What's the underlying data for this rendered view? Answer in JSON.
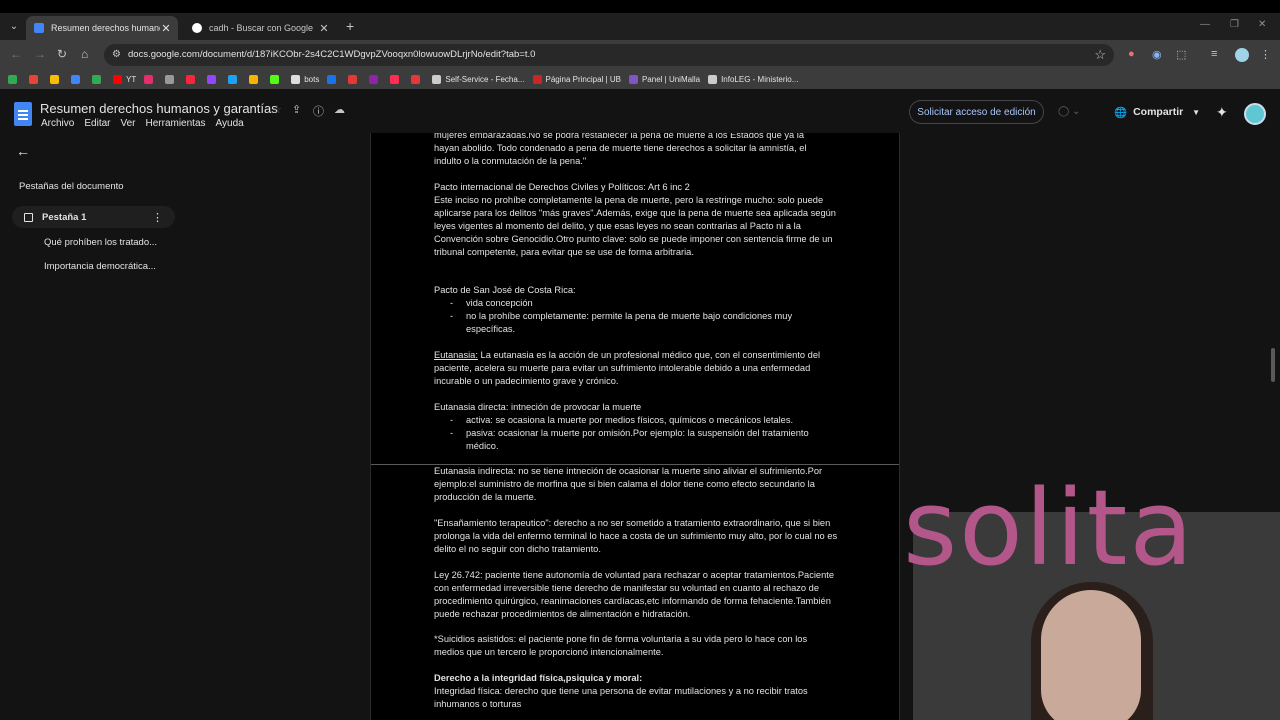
{
  "browser": {
    "tabs": [
      {
        "title": "Resumen derechos humanos y",
        "active": true,
        "favicon": "docs-icon"
      },
      {
        "title": "cadh - Buscar con Google",
        "active": false,
        "favicon": "google-icon"
      }
    ],
    "url": "docs.google.com/document/d/187iKCObr-2s4C2C1WDgvpZVooqxn0lowuowDLrjrNo/edit?tab=t.0",
    "bookmarks": [
      {
        "label": "",
        "color": "#34a853"
      },
      {
        "label": "",
        "color": "#ea4335"
      },
      {
        "label": "",
        "color": "#fbbc04"
      },
      {
        "label": "",
        "color": "#4285f4"
      },
      {
        "label": "",
        "color": "#34a853"
      },
      {
        "label": "YT",
        "color": "#ff0000"
      },
      {
        "label": "",
        "color": "#e1306c"
      },
      {
        "label": "",
        "color": "#999999"
      },
      {
        "label": "",
        "color": "#fa243c"
      },
      {
        "label": "",
        "color": "#9146ff"
      },
      {
        "label": "",
        "color": "#1da1f2"
      },
      {
        "label": "",
        "color": "#f7b500"
      },
      {
        "label": "",
        "color": "#53fc18"
      },
      {
        "label": "bots",
        "color": "#dddddd"
      },
      {
        "label": "",
        "color": "#1a73e8"
      },
      {
        "label": "",
        "color": "#e53935"
      },
      {
        "label": "",
        "color": "#8e24aa"
      },
      {
        "label": "",
        "color": "#ff2d55"
      },
      {
        "label": "",
        "color": "#e53935"
      },
      {
        "label": "Self-Service - Fecha...",
        "color": "#cccccc"
      },
      {
        "label": "Página Principal | UB",
        "color": "#c62828"
      },
      {
        "label": "Panel | UniMalla",
        "color": "#7e57c2"
      },
      {
        "label": "InfoLEG - Ministerio...",
        "color": "#cccccc"
      }
    ]
  },
  "docs": {
    "title": "Resumen derechos humanos y garantías",
    "menu": [
      "Archivo",
      "Editar",
      "Ver",
      "Herramientas",
      "Ayuda"
    ],
    "request_edit": "Solicitar acceso de edición",
    "share": "Compartir"
  },
  "sidebar": {
    "heading": "Pestañas del documento",
    "tab": "Pestaña 1",
    "subitems": [
      "Qué prohíben los tratado...",
      "Importancia democrática..."
    ]
  },
  "document": {
    "p1a": "mujeres embarazadas.No se podrá restablecer la pena de muerte a los Estados que ya la",
    "p1b": "hayan abolido.  Todo condenado a pena de muerte tiene derechos a solicitar la amnistía, el",
    "p1c": "indulto o la conmutación de la pena.\"",
    "p2_title": "Pacto internacional de Derechos Civiles y Políticos: Art 6 inc 2",
    "p2": "Este inciso no prohíbe completamente la pena de muerte, pero la restringe mucho: solo puede aplicarse para los delitos \"más graves\".Además, exige que la pena de muerte sea aplicada según leyes vigentes al momento del delito, y que esas leyes no sean contrarias al Pacto ni a la Convención sobre Genocidio.Otro punto clave: solo se puede imponer con sentencia firme de un tribunal competente, para evitar que se use de forma arbitraria.",
    "p3_title": "Pacto de San José de Costa Rica:",
    "p3_bullets": [
      "vida concepción",
      "no la prohíbe completamente: permite la pena de muerte bajo condiciones muy específicas."
    ],
    "p4_label": "Eutanasia:",
    "p4": " La eutanasia es la acción de un profesional médico que, con el consentimiento del paciente, acelera su muerte para evitar un sufrimiento intolerable debido a una enfermedad incurable o un padecimiento grave y crónico.",
    "p5_title": "Eutanasia directa: intneción de provocar la muerte",
    "p5_bullets": [
      "activa: se ocasiona la muerte por medios físicos, químicos o mecánicos letales.",
      "pasiva: ocasionar la muerte por omisión.Por ejemplo: la suspensión del tratamiento médico."
    ],
    "p6": "Eutanasia indirecta: no se tiene intneción de ocasionar la muerte sino aliviar el sufrimiento.Por ejemplo:el suministro de morfina que si bien calama el dolor tiene como efecto secundario la producción de la muerte.",
    "p7": "\"Ensañamiento terapeutico\": derecho a no ser sometido a tratamiento extraordinario, que si bien prolonga la vida del enfermo terminal lo hace a costa de un sufrimiento muy alto, por lo cual no es delito el no seguir con dicho tratamiento.",
    "p8": "Ley 26.742: paciente tiene autonomía de voluntad para rechazar o aceptar tratamientos.Paciente con enfermedad irreversible tiene derecho de manifestar su voluntad en cuanto al rechazo de procedimiento quirúrgico, reanimaciones cardíacas,etc informando de forma fehaciente.También puede rechazar procedimientos de alimentación e hidratación.",
    "p9": "*Suicidios asistidos: el paciente pone fin de forma voluntaria a su vida pero lo hace con los medios que un tercero le proporcionó intencionalmente.",
    "p10_title": "Derecho a la integridad física,psiquica y moral:",
    "p10": "Integridad física: derecho que tiene una persona de evitar mutilaciones y a no recibir tratos inhumanos o torturas"
  },
  "overlay_text": "solita"
}
